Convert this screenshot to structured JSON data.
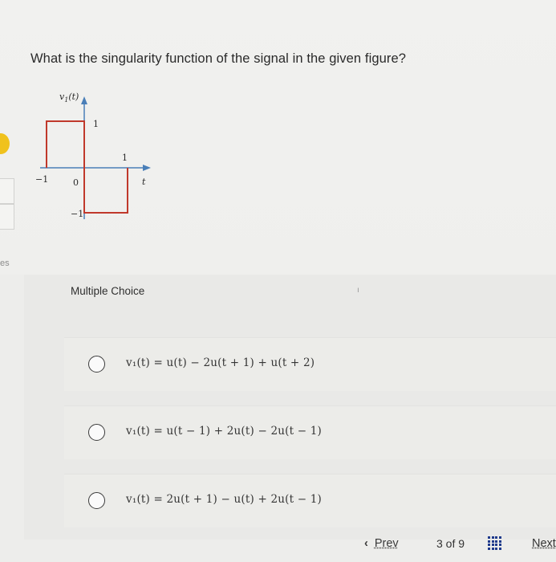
{
  "question": {
    "text": "What is the singularity function of the signal in the given figure?",
    "figure": {
      "y_label": "v",
      "y_label_sub": "1",
      "y_label_arg": "(t)",
      "x_label": "t",
      "tick_neg1": "−1",
      "tick_zero": "0",
      "tick_pos1": "1",
      "level_pos": "1",
      "level_neg": "−1",
      "signal_color": "#c0392b"
    }
  },
  "choices": {
    "header": "Multiple Choice",
    "options": [
      {
        "formula": "v₁(t) = u(t) − 2u(t + 1) + u(t + 2)"
      },
      {
        "formula": "v₁(t) = u(t − 1) + 2u(t) − 2u(t − 1)"
      },
      {
        "formula": "v₁(t) = 2u(t + 1) − u(t) + 2u(t − 1)"
      }
    ]
  },
  "footer": {
    "prev_label": "Prev",
    "page_count": "3 of 9",
    "next_label": "Next"
  },
  "side": {
    "cut_text": "es"
  }
}
